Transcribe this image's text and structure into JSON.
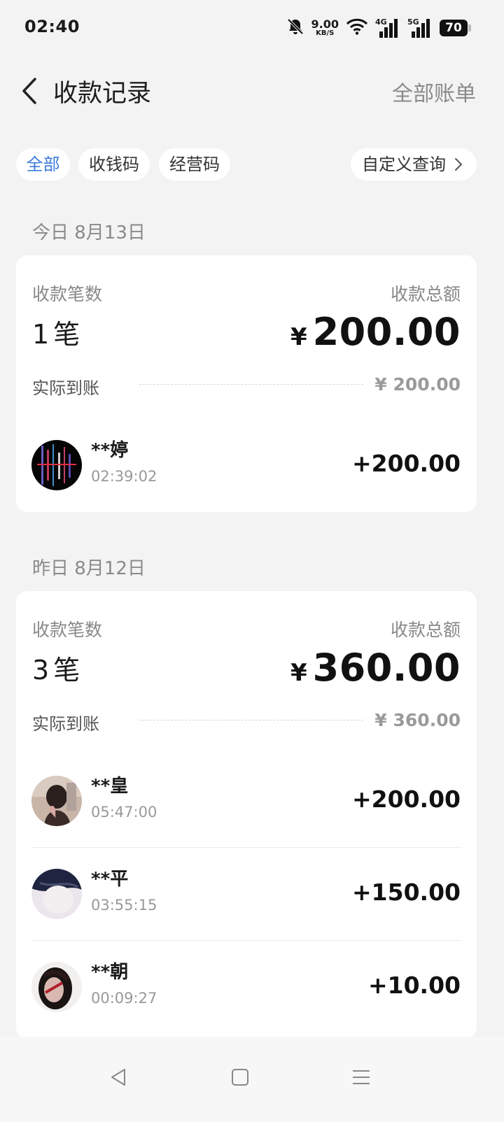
{
  "status_bar": {
    "time": "02:40",
    "net_speed": "9.00",
    "net_unit": "KB/S",
    "signal1_label": "4G",
    "signal2_label": "5G",
    "battery": "70",
    "icons": [
      "bell-muted-icon",
      "wifi-icon",
      "signal-icon",
      "signal-icon",
      "battery-icon"
    ]
  },
  "header": {
    "title": "收款记录",
    "right_link": "全部账单"
  },
  "filters": {
    "chips": [
      "全部",
      "收钱码",
      "经营码"
    ],
    "active_chip": "全部",
    "custom_query": "自定义查询",
    "accent_color": "#3b7bdc"
  },
  "sections": [
    {
      "date_label": "今日 8月13日",
      "count_label": "收款笔数",
      "total_label": "收款总额",
      "count": "1",
      "count_unit": "笔",
      "currency": "¥",
      "total": "200.00",
      "arrival_label": "实际到账",
      "arrival_value": "¥ 200.00",
      "transactions": [
        {
          "name": "**婷",
          "time": "02:39:02",
          "amount": "+200.00"
        }
      ]
    },
    {
      "date_label": "昨日 8月12日",
      "count_label": "收款笔数",
      "total_label": "收款总额",
      "count": "3",
      "count_unit": "笔",
      "currency": "¥",
      "total": "360.00",
      "arrival_label": "实际到账",
      "arrival_value": "¥ 360.00",
      "transactions": [
        {
          "name": "**皇",
          "time": "05:47:00",
          "amount": "+200.00"
        },
        {
          "name": "**平",
          "time": "03:55:15",
          "amount": "+150.00"
        },
        {
          "name": "**朝",
          "time": "00:09:27",
          "amount": "+10.00"
        }
      ]
    }
  ]
}
